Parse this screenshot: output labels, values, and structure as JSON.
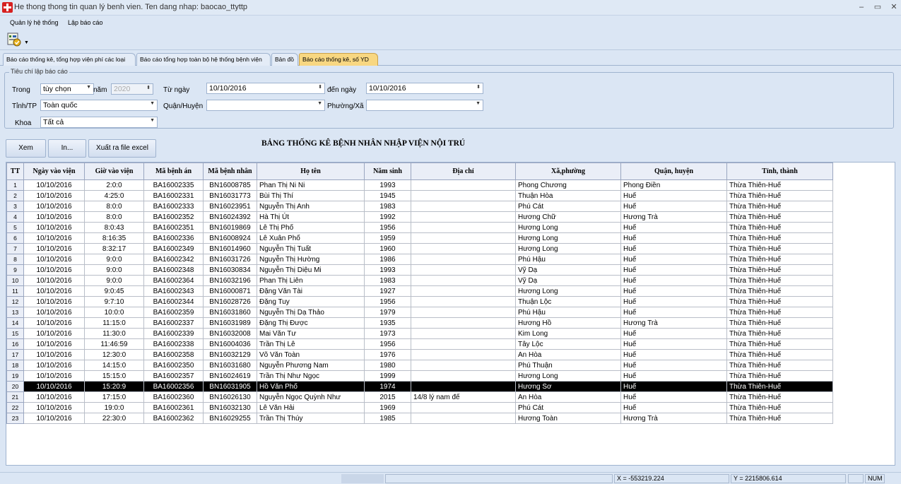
{
  "window": {
    "title": "He thong thong tin quan lý benh vien. Ten dang nhap: baocao_ttyttp",
    "minimize": "–",
    "restore": "▭",
    "close": "✕"
  },
  "menu": [
    "Quản lý hệ thống",
    "Lập báo cáo"
  ],
  "tabs": [
    "Báo cáo thống kê, tổng hợp viện phí các loại",
    "Báo cáo tổng hợp toàn bộ hệ thống bệnh viện",
    "Bản đồ",
    "Báo cáo thống kê, số YD"
  ],
  "filter": {
    "legend": "Tiêu chí lập báo cáo",
    "trong_label": "Trong",
    "trong_value": "tùy chọn",
    "nam_label": "năm",
    "nam_value": "2020",
    "tungay_label": "Từ ngày",
    "tungay_value": "10/10/2016",
    "denngay_label": "đến ngày",
    "denngay_value": "10/10/2016",
    "tinh_label": "Tỉnh/TP",
    "tinh_value": "Toàn quốc",
    "quan_label": "Quận/Huyện",
    "quan_value": "",
    "phuong_label": "Phường/Xã",
    "phuong_value": "",
    "khoa_label": "Khoa",
    "khoa_value": "Tất cả"
  },
  "actions": {
    "view": "Xem",
    "print": "In...",
    "export": "Xuất ra file excel"
  },
  "report_title": "BẢNG THỐNG KÊ BỆNH NHÂN NHẬP VIỆN NỘI TRÚ",
  "table": {
    "headers": [
      "TT",
      "Ngày vào viện",
      "Giờ vào viện",
      "Mã bệnh án",
      "Mã bệnh nhân",
      "Họ tên",
      "Năm sinh",
      "Địa chỉ",
      "Xã,phường",
      "Quận, huyện",
      "Tỉnh, thành"
    ],
    "selected_row": 19,
    "rows": [
      [
        "1",
        "10/10/2016",
        "2:0:0",
        "BA16002335",
        "BN16008785",
        "Phan Thị Ni Ni",
        "1993",
        "",
        "Phong Chương",
        "Phong Điền",
        "Thừa Thiên-Huế"
      ],
      [
        "2",
        "10/10/2016",
        "4:25:0",
        "BA16002331",
        "BN16031773",
        "Bùi Thị Thí",
        "1945",
        "",
        "Thuận Hòa",
        "Huế",
        "Thừa Thiên-Huế"
      ],
      [
        "3",
        "10/10/2016",
        "8:0:0",
        "BA16002333",
        "BN16023951",
        "Nguyễn Thị Anh",
        "1983",
        "",
        "Phú Cát",
        "Huế",
        "Thừa Thiên-Huế"
      ],
      [
        "4",
        "10/10/2016",
        "8:0:0",
        "BA16002352",
        "BN16024392",
        "Hà Thị Út",
        "1992",
        "",
        "Hương Chữ",
        "Hương Trà",
        "Thừa Thiên-Huế"
      ],
      [
        "5",
        "10/10/2016",
        "8:0:43",
        "BA16002351",
        "BN16019869",
        "Lê Thị Phố",
        "1956",
        "",
        "Hương Long",
        "Huế",
        "Thừa Thiên-Huế"
      ],
      [
        "6",
        "10/10/2016",
        "8:16:35",
        "BA16002336",
        "BN16008924",
        "Lê Xuân Phố",
        "1959",
        "",
        "Hương Long",
        "Huế",
        "Thừa Thiên-Huế"
      ],
      [
        "7",
        "10/10/2016",
        "8:32:17",
        "BA16002349",
        "BN16014960",
        "Nguyễn Thị Tuất",
        "1960",
        "",
        "Hương Long",
        "Huế",
        "Thừa Thiên-Huế"
      ],
      [
        "8",
        "10/10/2016",
        "9:0:0",
        "BA16002342",
        "BN16031726",
        "Nguyễn Thị Hường",
        "1986",
        "",
        "Phú Hậu",
        "Huế",
        "Thừa Thiên-Huế"
      ],
      [
        "9",
        "10/10/2016",
        "9:0:0",
        "BA16002348",
        "BN16030834",
        "Nguyễn Thị Diệu Mi",
        "1993",
        "",
        "Vỹ Dạ",
        "Huế",
        "Thừa Thiên-Huế"
      ],
      [
        "10",
        "10/10/2016",
        "9:0:0",
        "BA16002364",
        "BN16032196",
        "Phan Thị Liên",
        "1983",
        "",
        "Vỹ Dạ",
        "Huế",
        "Thừa Thiên-Huế"
      ],
      [
        "11",
        "10/10/2016",
        "9:0:45",
        "BA16002343",
        "BN16000871",
        "Đặng Văn Tài",
        "1927",
        "",
        "Hương Long",
        "Huế",
        "Thừa Thiên-Huế"
      ],
      [
        "12",
        "10/10/2016",
        "9:7:10",
        "BA16002344",
        "BN16028726",
        "Đặng Tuy",
        "1956",
        "",
        "Thuận Lộc",
        "Huế",
        "Thừa Thiên-Huế"
      ],
      [
        "13",
        "10/10/2016",
        "10:0:0",
        "BA16002359",
        "BN16031860",
        "Nguyễn Thị Dạ Thảo",
        "1979",
        "",
        "Phú Hậu",
        "Huế",
        "Thừa Thiên-Huế"
      ],
      [
        "14",
        "10/10/2016",
        "11:15:0",
        "BA16002337",
        "BN16031989",
        "Đặng Thị Được",
        "1935",
        "",
        "Hương Hồ",
        "Hương Trà",
        "Thừa Thiên-Huế"
      ],
      [
        "15",
        "10/10/2016",
        "11:30:0",
        "BA16002339",
        "BN16032008",
        "Mai Văn Tư",
        "1973",
        "",
        "Kim Long",
        "Huế",
        "Thừa Thiên-Huế"
      ],
      [
        "16",
        "10/10/2016",
        "11:46:59",
        "BA16002338",
        "BN16004036",
        "Trần Thị Lê",
        "1956",
        "",
        "Tây Lộc",
        "Huế",
        "Thừa Thiên-Huế"
      ],
      [
        "17",
        "10/10/2016",
        "12:30:0",
        "BA16002358",
        "BN16032129",
        "Võ Văn Toàn",
        "1976",
        "",
        "An Hòa",
        "Huế",
        "Thừa Thiên-Huế"
      ],
      [
        "18",
        "10/10/2016",
        "14:15:0",
        "BA16002350",
        "BN16031680",
        "Nguyễn Phương Nam",
        "1980",
        "",
        "Phú Thuận",
        "Huế",
        "Thừa Thiên-Huế"
      ],
      [
        "19",
        "10/10/2016",
        "15:15:0",
        "BA16002357",
        "BN16024619",
        "Trần Thị Như Ngọc",
        "1999",
        "",
        "Hương Long",
        "Huế",
        "Thừa Thiên-Huế"
      ],
      [
        "20",
        "10/10/2016",
        "15:20:9",
        "BA16002356",
        "BN16031905",
        "Hồ Văn Phố",
        "1974",
        "",
        "Hương Sơ",
        "Huế",
        "Thừa Thiên-Huế"
      ],
      [
        "21",
        "10/10/2016",
        "17:15:0",
        "BA16002360",
        "BN16026130",
        "Nguyễn Ngọc Quỳnh Như",
        "2015",
        "14/8 lý nam đế",
        "An Hòa",
        "Huế",
        "Thừa Thiên-Huế"
      ],
      [
        "22",
        "10/10/2016",
        "19:0:0",
        "BA16002361",
        "BN16032130",
        "Lê Văn Hải",
        "1969",
        "",
        "Phú Cát",
        "Huế",
        "Thừa Thiên-Huế"
      ],
      [
        "23",
        "10/10/2016",
        "22:30:0",
        "BA16002362",
        "BN16029255",
        "Trần Thị Thúy",
        "1985",
        "",
        "Hương Toàn",
        "Hương Trà",
        "Thừa Thiên-Huế"
      ]
    ]
  },
  "status": {
    "x": "X = -553219.224",
    "y": "Y = 2215806.614",
    "num": "NUM"
  },
  "icons": {
    "app": "app-cross-icon",
    "tool": "report-tool-icon",
    "dropdown": "chevron-down-icon",
    "spinner": "spinner-icon"
  }
}
